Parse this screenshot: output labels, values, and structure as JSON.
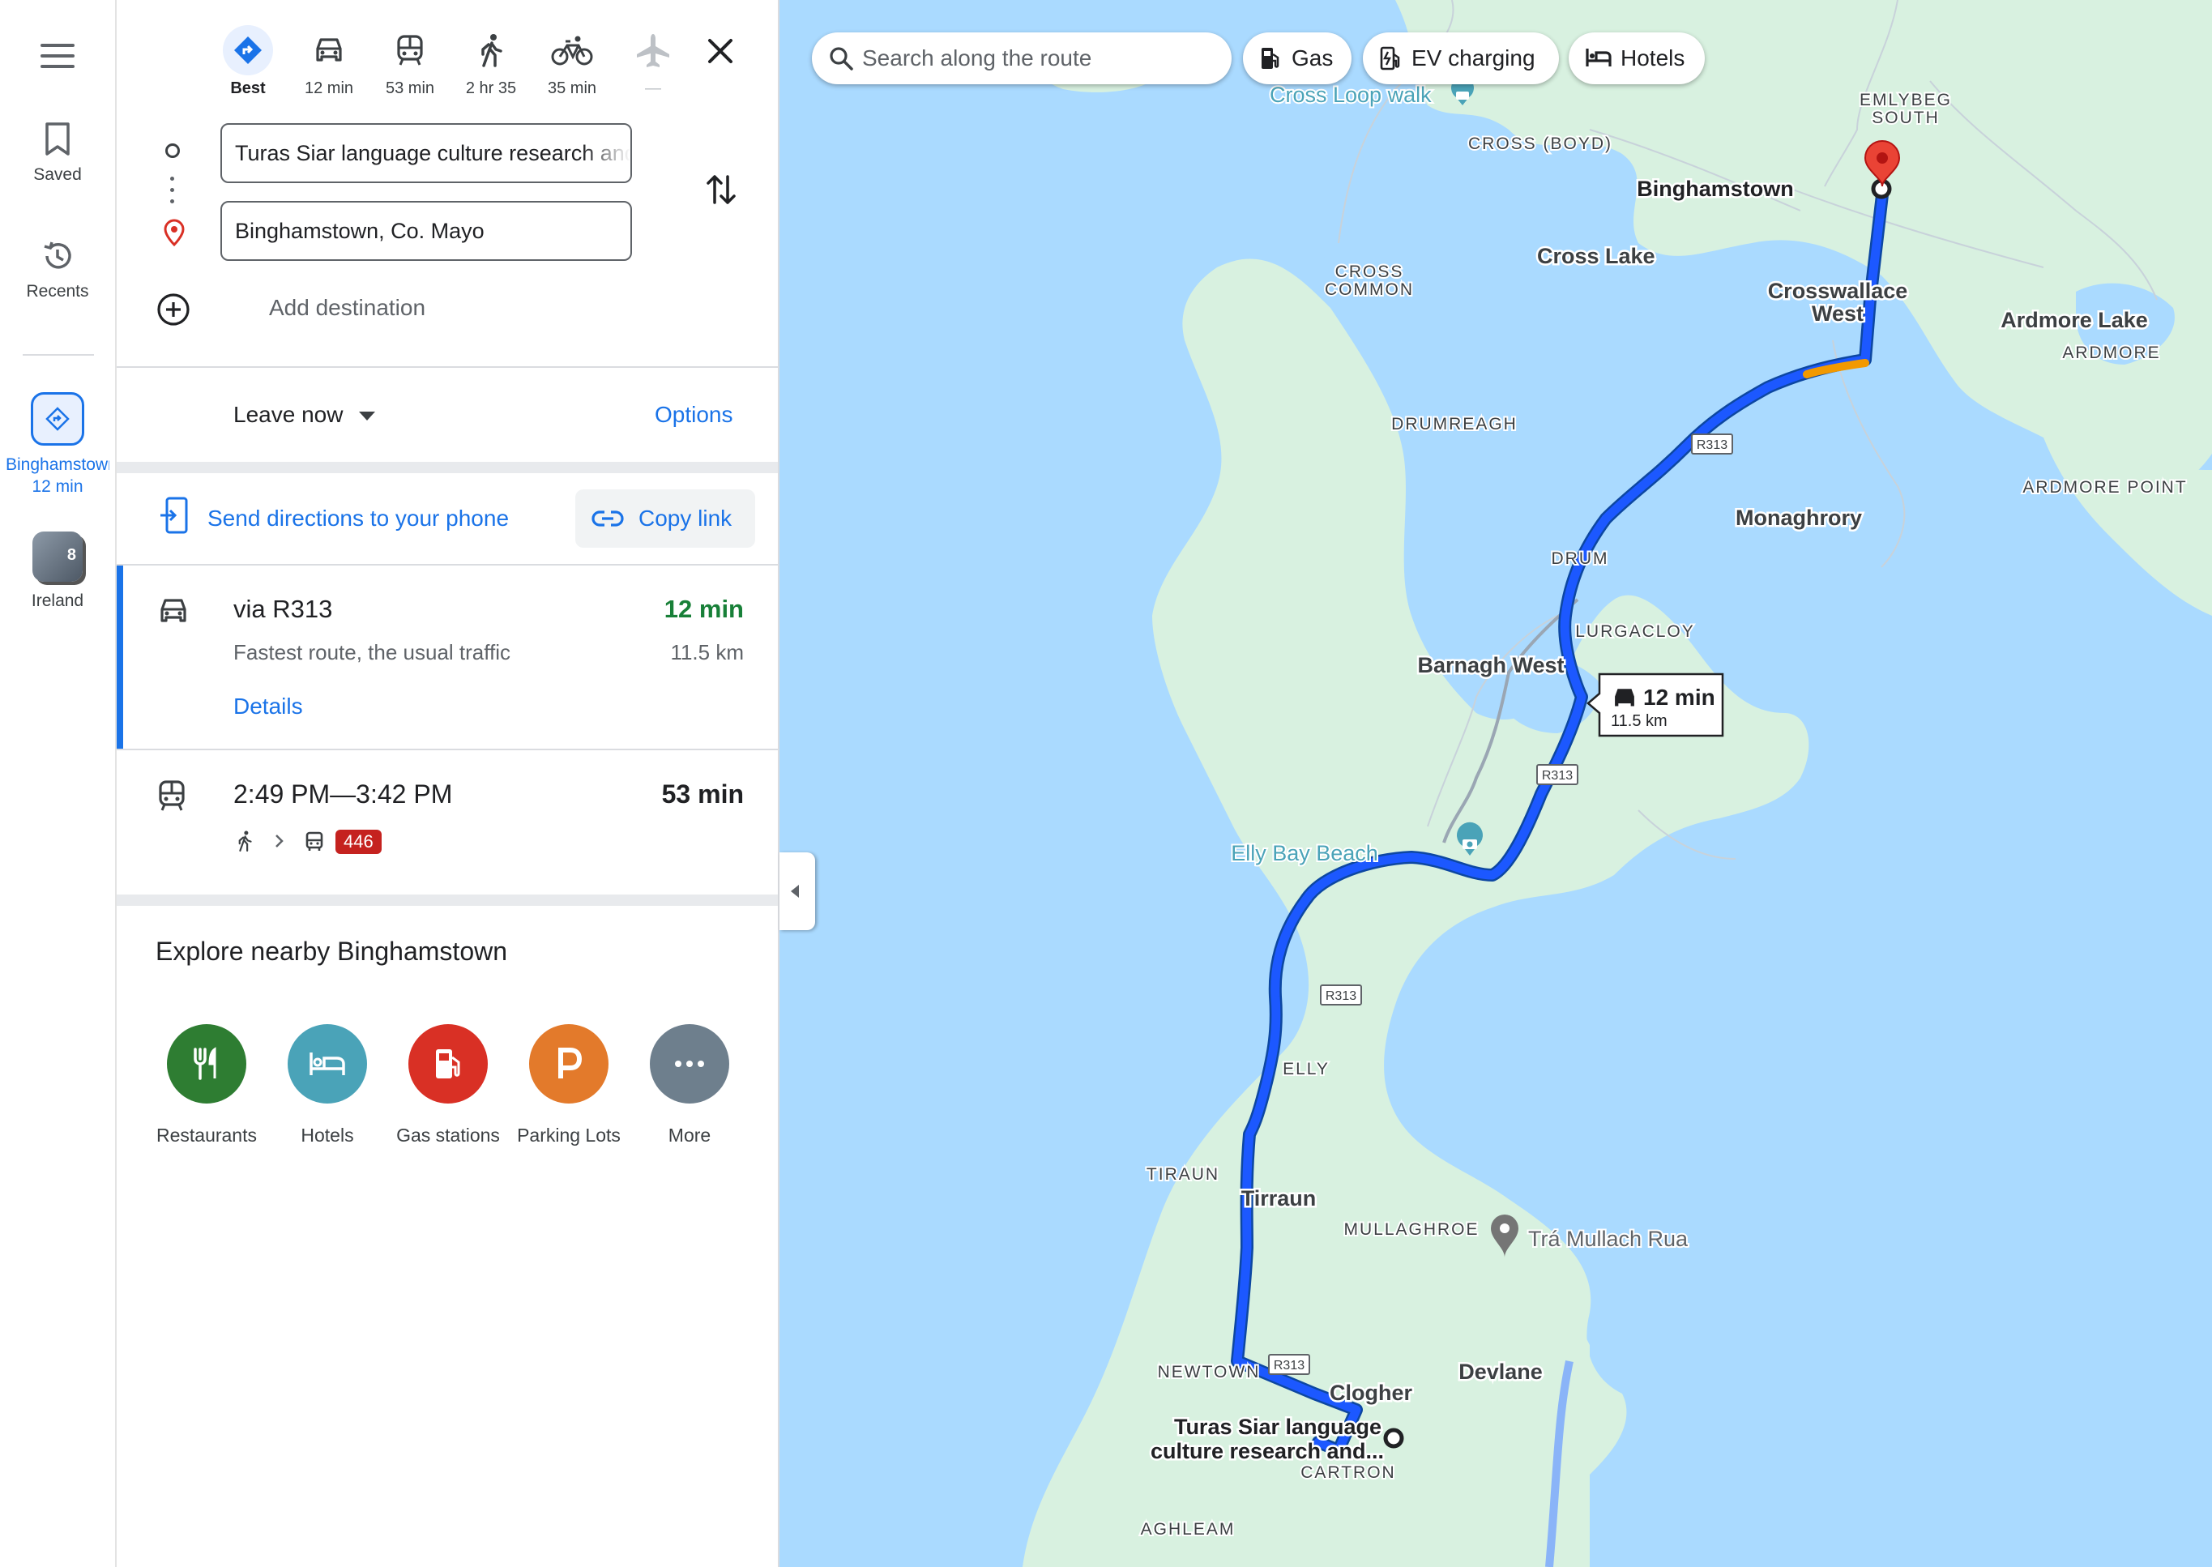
{
  "rail": {
    "saved_label": "Saved",
    "recents_label": "Recents",
    "active_trip": {
      "label": "Binghamstown",
      "time": "12 min"
    },
    "photo_count": "8",
    "photo_label": "Ireland"
  },
  "modes": [
    {
      "label": "Best",
      "icon": "directions-icon"
    },
    {
      "label": "12 min",
      "icon": "car-icon"
    },
    {
      "label": "53 min",
      "icon": "transit-icon"
    },
    {
      "label": "2 hr 35",
      "icon": "walk-icon"
    },
    {
      "label": "35 min",
      "icon": "bike-icon"
    },
    {
      "label": "—",
      "icon": "flight-icon"
    }
  ],
  "origin": "Turas Siar language culture research and genealogy centre",
  "destination": "Binghamstown, Co. Mayo",
  "add_destination": "Add destination",
  "leave_now": "Leave now",
  "options": "Options",
  "send_to_phone": "Send directions to your phone",
  "copy_link": "Copy link",
  "route": {
    "name": "via R313",
    "desc": "Fastest route, the usual traffic",
    "time": "12 min",
    "distance": "11.5 km",
    "details": "Details"
  },
  "transit": {
    "times": "2:49 PM—3:42 PM",
    "duration": "53 min",
    "bus": "446"
  },
  "explore": {
    "title": "Explore nearby Binghamstown",
    "categories": [
      {
        "label": "Restaurants",
        "color": "#2e7d32",
        "icon": "fork-knife-icon"
      },
      {
        "label": "Hotels",
        "color": "#4aa3b8",
        "icon": "bed-icon"
      },
      {
        "label": "Gas stations",
        "color": "#d93025",
        "icon": "gas-pump-icon"
      },
      {
        "label": "Parking Lots",
        "color": "#e37a2b",
        "icon": "parking-icon"
      },
      {
        "label": "More",
        "color": "#6e7f8d",
        "icon": "more-icon"
      }
    ]
  },
  "map": {
    "search_placeholder": "Search along the route",
    "chips": [
      "Gas",
      "EV charging",
      "Hotels"
    ],
    "route_bubble": {
      "time": "12 min",
      "distance": "11.5 km"
    },
    "labels": {
      "cross_loop": "Cross Loop walk",
      "emlybeg": [
        "EMLYBEG",
        "SOUTH"
      ],
      "cross_boyd": "CROSS (BOYD)",
      "binghamstown": "Binghamstown",
      "cross_lake": "Cross Lake",
      "cross_common": [
        "CROSS",
        "COMMON"
      ],
      "crosswallace": [
        "Crosswallace",
        "West"
      ],
      "ardmore_lake": "Ardmore Lake",
      "ardmore": "ARDMORE",
      "ardmore_point": "ARDMORE POINT",
      "drumreagh": "DRUMREAGH",
      "monaghrory": "Monaghrory",
      "drum": "DRUM",
      "lurgacloy": "LURGACLOY",
      "barnagh": "Barnagh West",
      "elly_bay": "Elly Bay Beach",
      "elly": "ELLY",
      "tiraun": "TIRAUN",
      "tirraun": "Tirraun",
      "mullaghroe": "MULLAGHROE",
      "tra_mullach": "Trá Mullach Rua",
      "newtown": "NEWTOWN",
      "devlane": "Devlane",
      "clogher": "Clogher",
      "turas": [
        "Turas Siar language",
        "culture research and..."
      ],
      "cartron": "CARTRON",
      "aghleam": "AGHLEAM",
      "road": "R313"
    }
  }
}
